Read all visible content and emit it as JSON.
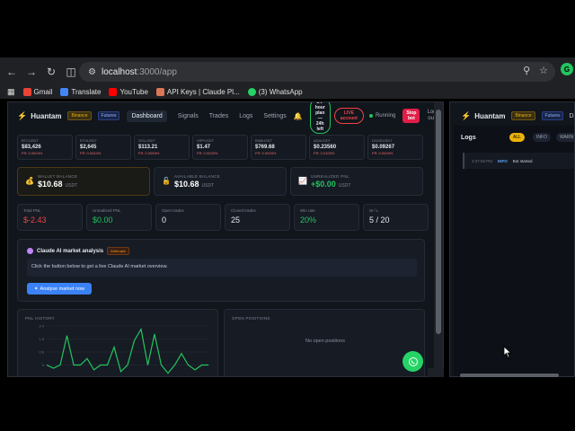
{
  "browser": {
    "url_host": "localhost",
    "url_path": ":3000/app",
    "bookmarks": [
      {
        "label": "Gmail",
        "color": "#ea4335"
      },
      {
        "label": "Translate",
        "color": "#4285f4"
      },
      {
        "label": "YouTube",
        "color": "#ff0000"
      },
      {
        "label": "API Keys | Claude Pl...",
        "color": "#d97757"
      },
      {
        "label": "(3) WhatsApp",
        "color": "#25d366"
      }
    ],
    "profile_initial": "G"
  },
  "app": {
    "brand": "Huantam",
    "tag_exchange": "Binance",
    "tag_market": "Futures",
    "nav": [
      "Dashboard",
      "Signals",
      "Trades",
      "Logs",
      "Settings"
    ],
    "plan_line1": "24-hour",
    "plan_line2": "plan —",
    "plan_line3": "24h left",
    "live_line1": "LIVE",
    "live_line2": "account",
    "running": "Running",
    "stop_line1": "Stop",
    "stop_line2": "bot",
    "logout_line1": "Log",
    "logout_line2": "out"
  },
  "tickers": [
    {
      "symbol": "BTCUSDT",
      "price": "$83,426",
      "fr": "FR: 0.0004%"
    },
    {
      "symbol": "ETHUSDT",
      "price": "$2,645",
      "fr": "FR: 0.0044%"
    },
    {
      "symbol": "SOLUSDT",
      "price": "$113.21",
      "fr": "FR: 0.0053%"
    },
    {
      "symbol": "XRPUSDT",
      "price": "$1.47",
      "fr": "FR: 0.0033%"
    },
    {
      "symbol": "BNBUSDT",
      "price": "$769.68",
      "fr": "FR: 0.0000%"
    },
    {
      "symbol": "ADAUSDT",
      "price": "$0.23560",
      "fr": "FR: 0.0100%"
    },
    {
      "symbol": "DOGEUSDT",
      "price": "$0.09267",
      "fr": "FR: 0.0049%"
    }
  ],
  "balances": [
    {
      "label": "WALLET BALANCE",
      "value": "$10.68",
      "unit": "USDT"
    },
    {
      "label": "AVAILABLE BALANCE",
      "value": "$10.68",
      "unit": "USDT"
    },
    {
      "label": "UNREALIZED PNL",
      "value": "+$0.00",
      "unit": "USDT"
    }
  ],
  "stats": [
    {
      "label": "Total PNL",
      "value": "$-2.43"
    },
    {
      "label": "Unrealized PNL",
      "value": "$0.00"
    },
    {
      "label": "Open trades",
      "value": "0"
    },
    {
      "label": "Closed trades",
      "value": "25"
    },
    {
      "label": "Win rate",
      "value": "20%"
    },
    {
      "label": "W / L",
      "value": "5 / 20"
    }
  ],
  "ai": {
    "title": "Claude AI market analysis",
    "tag": "Anthropic",
    "prompt": "Click the button below to get a live Claude AI market overview.",
    "button": "Analyse market now"
  },
  "pnl_history": {
    "title": "PNL HISTORY",
    "y_ticks": [
      "2.4",
      "1.6",
      "0.8",
      "0",
      "-0.8"
    ]
  },
  "chart_data": {
    "type": "line",
    "title": "PNL HISTORY",
    "xlabel": "",
    "ylabel": "",
    "ylim": [
      -0.8,
      2.4
    ],
    "grid": true,
    "series": [
      {
        "values": [
          0,
          -0.2,
          0,
          1.8,
          0,
          0,
          0.4,
          -0.3,
          0,
          0,
          1.1,
          -0.4,
          0,
          1.5,
          2.2,
          0,
          1.9,
          0,
          -0.5,
          0,
          0.7,
          0,
          -0.3,
          0,
          0
        ]
      }
    ]
  },
  "open_positions": {
    "title": "OPEN POSITIONS",
    "empty": "No open positions"
  },
  "logs": {
    "title": "Logs",
    "filters": [
      "ALL",
      "INFO",
      "WARN"
    ],
    "entry": {
      "time": "3:37:58 PM",
      "level": "INFO",
      "message": "Bot started"
    }
  },
  "colors": {
    "accent_yellow": "#eab308",
    "positive": "#22c55e",
    "negative": "#ef4444",
    "primary_button": "#3b82f6"
  }
}
